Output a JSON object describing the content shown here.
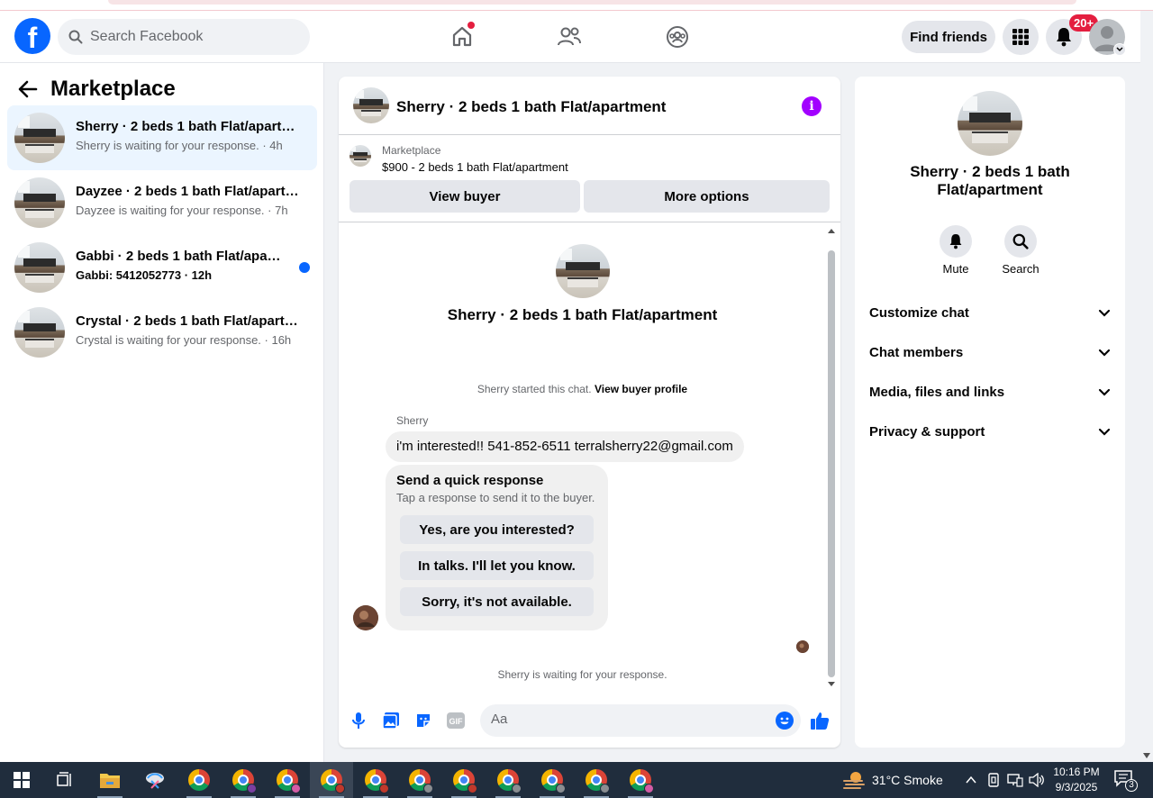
{
  "header": {
    "search_placeholder": "Search Facebook",
    "find_friends_label": "Find friends",
    "notification_count": "20+"
  },
  "sidebar": {
    "title": "Marketplace",
    "conversations": [
      {
        "name": "Sherry · 2 beds 1 bath Flat/apartment",
        "subtitle": "Sherry is waiting for your response. · 4h",
        "active": true,
        "unread": false
      },
      {
        "name": "Dayzee · 2 beds 1 bath Flat/apartment",
        "subtitle": "Dayzee is waiting for your response. · 7h",
        "active": false,
        "unread": false
      },
      {
        "name": "Gabbi · 2 beds 1 bath Flat/apartment",
        "subtitle": "Gabbi: 5412052773 · 12h",
        "active": false,
        "unread": true
      },
      {
        "name": "Crystal · 2 beds 1 bath Flat/apartment",
        "subtitle": "Crystal is waiting for your response. · 16h",
        "active": false,
        "unread": false
      }
    ]
  },
  "chat": {
    "title": "Sherry · 2 beds 1 bath Flat/apartment",
    "listing_label": "Marketplace",
    "listing_price": "$900 - 2 beds 1 bath Flat/apartment",
    "view_buyer_label": "View buyer",
    "more_options_label": "More options",
    "center_title": "Sherry · 2 beds 1 bath Flat/apartment",
    "started_text": "Sherry started this chat.",
    "view_profile_link": "View buyer profile",
    "sender_name": "Sherry",
    "message": "i'm interested!! 541-852-6511 terralsherry22@gmail.com",
    "quick_response": {
      "title": "Send a quick response",
      "subtitle": "Tap a response to send it to the buyer.",
      "options": [
        "Yes, are you interested?",
        "In talks. I'll let you know.",
        "Sorry, it's not available."
      ]
    },
    "waiting_text": "Sherry is waiting for your response.",
    "composer_placeholder": "Aa"
  },
  "info_panel": {
    "title": "Sherry · 2 beds 1 bath Flat/apartment",
    "actions": [
      {
        "label": "Mute",
        "icon": "bell-icon"
      },
      {
        "label": "Search",
        "icon": "search-icon"
      }
    ],
    "sections": [
      "Customize chat",
      "Chat members",
      "Media, files and links",
      "Privacy & support"
    ]
  },
  "taskbar": {
    "weather": "31°C  Smoke",
    "time": "10:16 PM",
    "date": "9/3/2025",
    "notification_count": "3"
  },
  "colors": {
    "brand_blue": "#0866ff",
    "badge_red": "#e41e3f",
    "info_purple": "#a200ff"
  }
}
